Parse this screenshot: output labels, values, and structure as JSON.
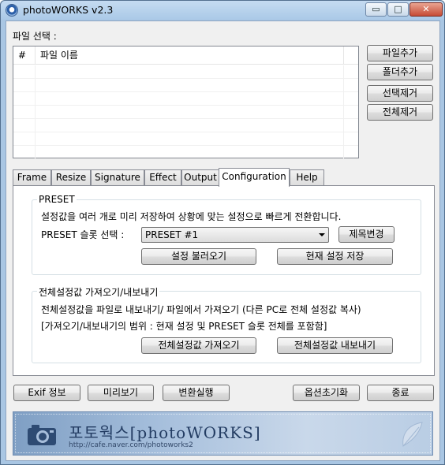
{
  "window": {
    "title": "photoWORKS v2.3",
    "min_glyph": "▭",
    "max_glyph": "□",
    "close_glyph": "✕"
  },
  "file_section": {
    "label": "파일 선택 :",
    "columns": [
      "#",
      "파일 이름"
    ],
    "buttons": {
      "add_file": "파일추가",
      "add_folder": "폴더추가",
      "remove_selected": "선택제거",
      "remove_all": "전체제거"
    }
  },
  "tabs": [
    "Frame",
    "Resize",
    "Signature",
    "Effect",
    "Output",
    "Configuration",
    "Help"
  ],
  "active_tab": "Configuration",
  "preset": {
    "group_title": "PRESET",
    "description": "설정값을 여러 개로 미리 저장하여 상황에 맞는 설정으로 빠르게 전환합니다.",
    "slot_label": "PRESET 슬롯 선택 :",
    "selected_slot": "PRESET #1",
    "rename_button": "제목변경",
    "load_button": "설정 불러오기",
    "save_button": "현재 설정 저장"
  },
  "import_export": {
    "group_title": "전체설정값 가져오기/내보내기",
    "description": "전체설정값을 파일로 내보내기/ 파일에서 가져오기 (다른 PC로 전체 설정값 복사)",
    "scope_note": "[가져오기/내보내기의 범위 : 현재 설정 및 PRESET 슬롯 전체를 포함함]",
    "import_button": "전체설정값 가져오기",
    "export_button": "전체설정값 내보내기"
  },
  "bottom_buttons": {
    "exif": "Exif 정보",
    "preview": "미리보기",
    "convert": "변환실행",
    "reset_options": "옵션초기화",
    "exit": "종료"
  },
  "banner": {
    "title": "포토웍스[photoWORKS]",
    "url": "http://cafe.naver.com/photoworks2"
  }
}
